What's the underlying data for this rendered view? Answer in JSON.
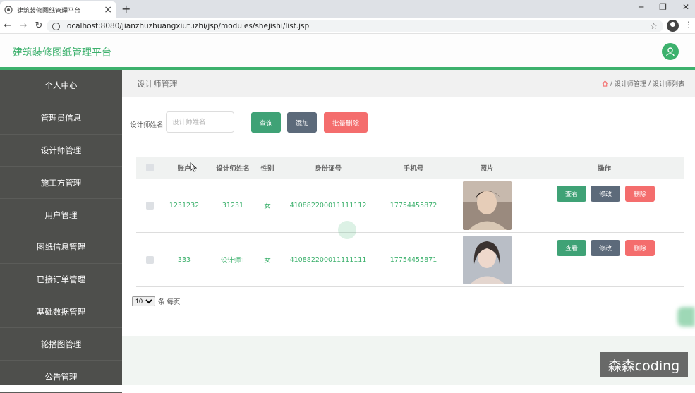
{
  "browser": {
    "tab_title": "建筑装修图纸管理平台",
    "url": "localhost:8080/jianzhuzhuangxiutuzhi/jsp/modules/shejishi/list.jsp"
  },
  "app": {
    "title": "建筑装修图纸管理平台",
    "accent": "#3db16d"
  },
  "sidebar": {
    "items": [
      {
        "label": "个人中心"
      },
      {
        "label": "管理员信息"
      },
      {
        "label": "设计师管理"
      },
      {
        "label": "施工方管理"
      },
      {
        "label": "用户管理"
      },
      {
        "label": "图纸信息管理"
      },
      {
        "label": "已接订单管理"
      },
      {
        "label": "基础数据管理"
      },
      {
        "label": "轮播图管理"
      },
      {
        "label": "公告管理"
      }
    ]
  },
  "main": {
    "page_title": "设计师管理",
    "breadcrumb": [
      "设计师管理",
      "设计师列表"
    ],
    "search": {
      "label": "设计师姓名",
      "placeholder": "设计师姓名",
      "value": ""
    },
    "buttons": {
      "query": "查询",
      "add": "添加",
      "bulk_delete": "批量删除"
    },
    "table": {
      "headers": [
        "账户",
        "设计师姓名",
        "性别",
        "身份证号",
        "手机号",
        "照片",
        "操作"
      ],
      "rows": [
        {
          "account": "1231232",
          "name": "31231",
          "gender": "女",
          "id_number": "410882200011111112",
          "phone": "17754455872",
          "photo": "male-portrait"
        },
        {
          "account": "333",
          "name": "设计师1",
          "gender": "女",
          "id_number": "410882200011111111",
          "phone": "17754455871",
          "photo": "female-portrait"
        }
      ],
      "row_actions": {
        "view": "查看",
        "edit": "修改",
        "delete": "删除"
      }
    },
    "pager": {
      "page_size": "10",
      "suffix": "条 每页"
    }
  },
  "watermark": "森森coding"
}
